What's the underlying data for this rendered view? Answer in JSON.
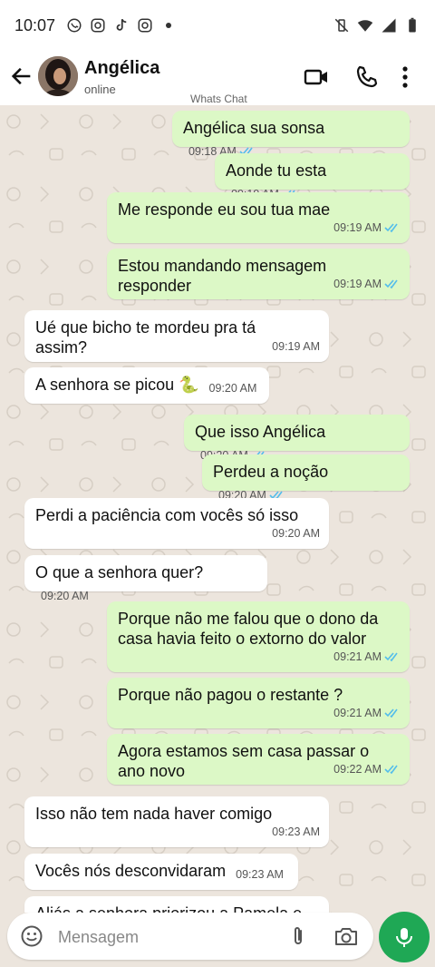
{
  "status_bar": {
    "time": "10:07",
    "left_icons": [
      "whatsapp-icon",
      "instagram-icon",
      "tiktok-icon",
      "instagram-icon"
    ],
    "right_icons": [
      "vibrate-off-icon",
      "wifi-icon",
      "signal-icon",
      "battery-icon"
    ]
  },
  "header": {
    "contact_name": "Angélica",
    "contact_status": "online",
    "watermark": "Whats Chat"
  },
  "messages": [
    {
      "dir": "out",
      "text": "Angélica sua sonsa",
      "time": "09:18 AM",
      "ticks": true
    },
    {
      "dir": "out",
      "text": "Aonde tu esta",
      "time": "09:19 AM",
      "ticks": true
    },
    {
      "dir": "out",
      "text": "Me responde eu sou tua mae",
      "time": "09:19 AM",
      "ticks": true
    },
    {
      "dir": "out",
      "text": "Estou mandando mensagem responder",
      "time": "09:19 AM",
      "ticks": true
    },
    {
      "dir": "in",
      "text": "Ué que bicho te mordeu pra tá assim?",
      "time": "09:19 AM"
    },
    {
      "dir": "in",
      "text": "A senhora se picou 🐍",
      "time": "09:20 AM"
    },
    {
      "dir": "out",
      "text": "Que isso Angélica",
      "time": "09:20 AM",
      "ticks": true
    },
    {
      "dir": "out",
      "text": "Perdeu a noção",
      "time": "09:20 AM",
      "ticks": true
    },
    {
      "dir": "in",
      "text": "Perdi a paciência com vocês só isso",
      "time": "09:20 AM"
    },
    {
      "dir": "in",
      "text": "O que a senhora quer?",
      "time": "09:20 AM"
    },
    {
      "dir": "out",
      "text": "Porque não me falou que o dono da casa havia feito o extorno do valor",
      "time": "09:21 AM",
      "ticks": true
    },
    {
      "dir": "out",
      "text": "Porque não pagou o restante ?",
      "time": "09:21 AM",
      "ticks": true
    },
    {
      "dir": "out",
      "text": "Agora estamos sem casa passar o ano novo",
      "time": "09:22 AM",
      "ticks": true
    },
    {
      "dir": "in",
      "text": "Isso não tem nada haver comigo",
      "time": "09:23 AM"
    },
    {
      "dir": "in",
      "text": "Vocês nós desconvidaram",
      "time": "09:23 AM"
    },
    {
      "dir": "in",
      "text": "Aliás a senhora priorizou a Pamela e",
      "time": ""
    }
  ],
  "input": {
    "placeholder": "Mensagem"
  },
  "colors": {
    "outgoing_bubble": "#DCF8C6",
    "incoming_bubble": "#FFFFFF",
    "chat_background": "#ECE5DD",
    "tick_blue": "#53BDEB",
    "mic_green": "#1FA855"
  }
}
